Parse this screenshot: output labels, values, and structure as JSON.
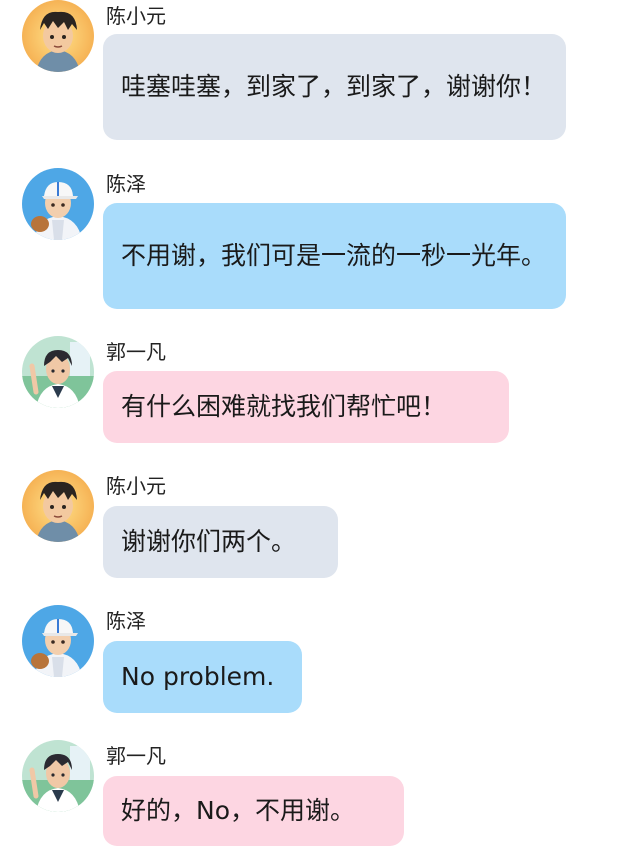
{
  "colors": {
    "bubble_gray": "#dfe5ee",
    "bubble_blue": "#a9dcfb",
    "bubble_pink": "#fdd6e2"
  },
  "messages": [
    {
      "sender": "陈小元",
      "avatar": "chen-xiaoyuan-avatar",
      "text": "哇塞哇塞，到家了，到家了，谢谢你！"
    },
    {
      "sender": "陈泽",
      "avatar": "chen-ze-avatar",
      "text": "不用谢，我们可是一流的一秒一光年。"
    },
    {
      "sender": "郭一凡",
      "avatar": "guo-yifan-avatar",
      "text": "有什么困难就找我们帮忙吧！"
    },
    {
      "sender": "陈小元",
      "avatar": "chen-xiaoyuan-avatar",
      "text": "谢谢你们两个。"
    },
    {
      "sender": "陈泽",
      "avatar": "chen-ze-avatar",
      "text": "No problem."
    },
    {
      "sender": "郭一凡",
      "avatar": "guo-yifan-avatar",
      "text": "好的，No，不用谢。"
    }
  ]
}
